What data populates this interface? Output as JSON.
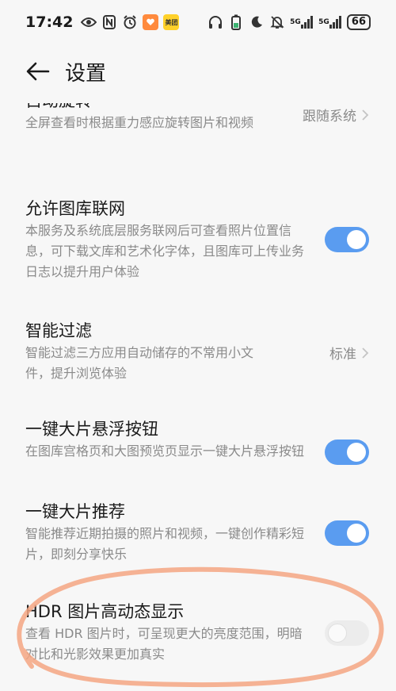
{
  "status_bar": {
    "time": "17:42",
    "network": "5G",
    "battery": "66",
    "app_badge_label": "美团"
  },
  "header": {
    "title": "设置"
  },
  "settings": [
    {
      "title": "自动旋转",
      "desc": "全屏查看时根据重力感应旋转图片和视频",
      "value": "跟随系统"
    },
    {
      "title": "允许图库联网",
      "desc": "本服务及系统底层服务联网后可查看照片位置信息，可下载文库和艺术化字体，且图库可上传业务日志以提升用户体验",
      "toggle": true
    },
    {
      "title": "智能过滤",
      "desc": "智能过滤三方应用自动储存的不常用小文件，提升浏览体验",
      "value": "标准"
    },
    {
      "title": "一键大片悬浮按钮",
      "desc": "在图库宫格页和大图预览页显示一键大片悬浮按钮",
      "toggle": true
    },
    {
      "title": "一键大片推荐",
      "desc": "智能推荐近期拍摄的照片和视频，一键创作精彩短片，即刻分享快乐",
      "toggle": true
    },
    {
      "title": "HDR 图片高动态显示",
      "desc": "查看 HDR 图片时，可呈现更大的亮度范围，明暗对比和光影效果更加真实",
      "toggle": false
    }
  ],
  "colors": {
    "accent": "#5a9cf0",
    "annotation": "#f4a683",
    "background": "#f7f7f7"
  }
}
